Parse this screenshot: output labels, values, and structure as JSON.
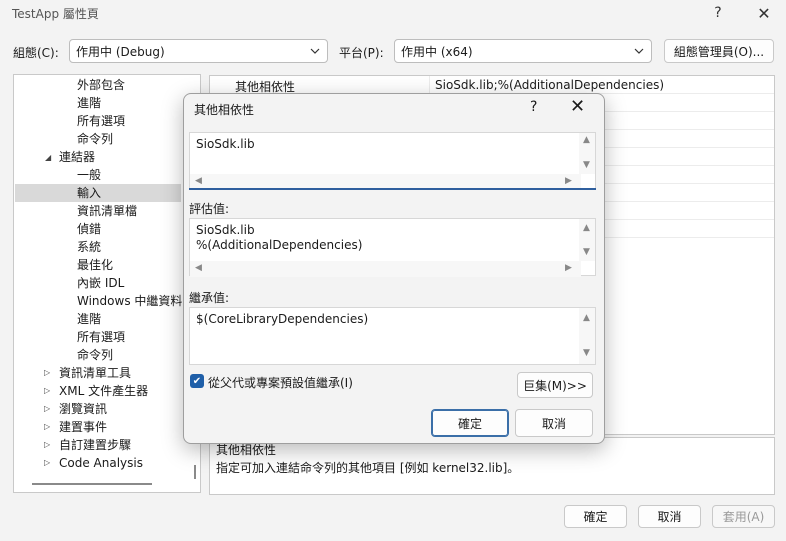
{
  "window": {
    "title": "TestApp 屬性頁",
    "help_glyph": "?",
    "close_glyph": "✕"
  },
  "toolbar": {
    "config_label": "組態(C):",
    "config_value": "作用中 (Debug)",
    "platform_label": "平台(P):",
    "platform_value": "作用中 (x64)",
    "config_manager_label": "組態管理員(O)..."
  },
  "tree": {
    "items": [
      {
        "label": "外部包含",
        "level": 2
      },
      {
        "label": "進階",
        "level": 2
      },
      {
        "label": "所有選項",
        "level": 2
      },
      {
        "label": "命令列",
        "level": 2
      },
      {
        "label": "連結器",
        "level": 1,
        "expanded": true
      },
      {
        "label": "一般",
        "level": 2
      },
      {
        "label": "輸入",
        "level": 2,
        "selected": true
      },
      {
        "label": "資訊清單檔",
        "level": 2
      },
      {
        "label": "偵錯",
        "level": 2
      },
      {
        "label": "系統",
        "level": 2
      },
      {
        "label": "最佳化",
        "level": 2
      },
      {
        "label": "內嵌 IDL",
        "level": 2
      },
      {
        "label": "Windows 中繼資料",
        "level": 2
      },
      {
        "label": "進階",
        "level": 2
      },
      {
        "label": "所有選項",
        "level": 2
      },
      {
        "label": "命令列",
        "level": 2
      },
      {
        "label": "資訊清單工具",
        "level": 1,
        "expanded": false
      },
      {
        "label": "XML 文件產生器",
        "level": 1,
        "expanded": false
      },
      {
        "label": "瀏覽資訊",
        "level": 1,
        "expanded": false
      },
      {
        "label": "建置事件",
        "level": 1,
        "expanded": false
      },
      {
        "label": "自訂建置步驟",
        "level": 1,
        "expanded": false
      },
      {
        "label": "Code Analysis",
        "level": 1,
        "expanded": false
      }
    ]
  },
  "grid": {
    "rows": [
      {
        "name": "其他相依性",
        "value": "SioSdk.lib;%(AdditionalDependencies)"
      }
    ]
  },
  "description": {
    "title": "其他相依性",
    "text": "指定可加入連結命令列的其他項目 [例如 kernel32.lib]。"
  },
  "footer": {
    "ok": "確定",
    "cancel": "取消",
    "apply": "套用(A)"
  },
  "dialog": {
    "title": "其他相依性",
    "help_glyph": "?",
    "close_glyph": "✕",
    "edit_value": "SioSdk.lib",
    "evaluated_label": "評估值:",
    "evaluated_value": "SioSdk.lib\n%(AdditionalDependencies)",
    "inherited_label": "繼承值:",
    "inherited_value": "$(CoreLibraryDependencies)",
    "inherit_checkbox_label": "從父代或專案預設值繼承(I)",
    "inherit_checked": true,
    "macros_button": "巨集(M)>>",
    "ok": "確定",
    "cancel": "取消"
  }
}
